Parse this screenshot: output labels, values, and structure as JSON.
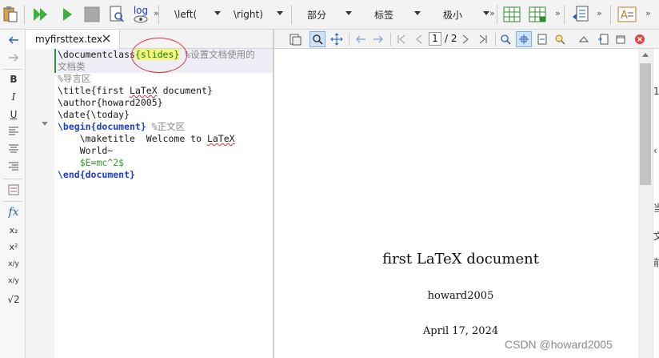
{
  "toolbar": {
    "dropdowns": [
      {
        "label": "\\left("
      },
      {
        "label": "\\right)"
      },
      {
        "label": "部分"
      },
      {
        "label": "标签"
      },
      {
        "label": "极小"
      }
    ],
    "log_label": "log",
    "more_glyph": "»"
  },
  "lefttoolbar": {
    "bold": "B",
    "italic": "I",
    "underline": "U",
    "fx": "fx",
    "subscript": "x₂",
    "superscript": "x²",
    "frac": "x/y",
    "dfrac": "x/y",
    "sqrt": "√2"
  },
  "editor": {
    "tab_label": "myfirsttex.tex",
    "lines": {
      "l1_cmd": "\\documentclass",
      "l1_arg": "{slides}",
      "l1_cmt": " %设置文档使用的",
      "l2": "文档类",
      "l3": "%导言区",
      "l4_a": "\\title{first ",
      "l4_b": "LaTeX",
      "l4_c": " document}",
      "l5": "\\author{howard2005}",
      "l6": "\\date{\\today}",
      "l7_cmd": "\\begin",
      "l7_arg": "{document}",
      "l7_cmt": " %正文区",
      "l8_a": "    \\maketitle  Welcome to ",
      "l8_b": "LaTeX",
      "l9": "    World~",
      "l10": "    $E=mc^2$",
      "l11_cmd": "\\end",
      "l11_arg": "{document}"
    }
  },
  "viewer": {
    "page_current": "1",
    "page_total": "/ 2",
    "pdf_title": "first LaTeX document",
    "pdf_author": "howard2005",
    "pdf_date": "April 17, 2024"
  },
  "peek": [
    "1",
    "‹",
    "当",
    "文",
    "前"
  ],
  "watermark": "CSDN @howard2005",
  "colors": {
    "keyword_blue": "#1f3fd1",
    "comment_gray": "#888888",
    "math_green": "#2a9a2a",
    "highlight_yellow": "#f2f77a",
    "annotation_red": "#e03535"
  }
}
